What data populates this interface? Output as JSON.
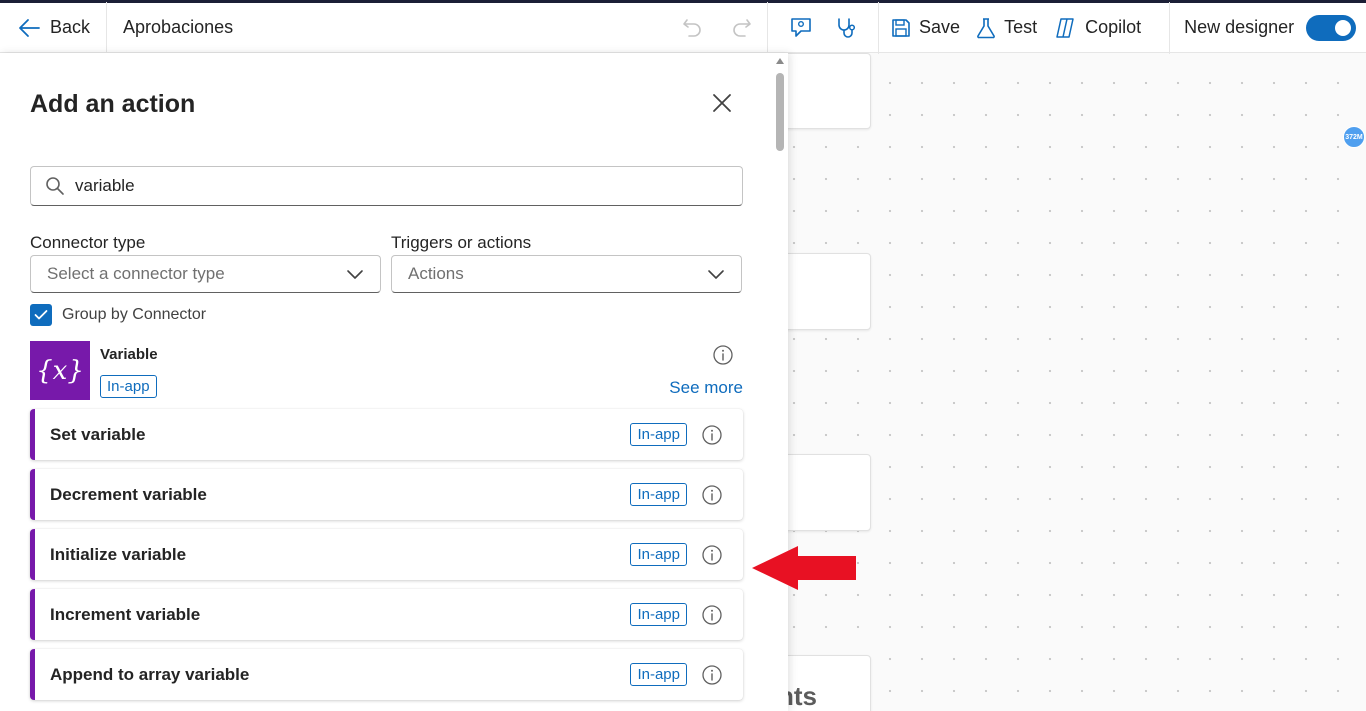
{
  "topbar": {
    "back_label": "Back",
    "flow_name": "Aprobaciones",
    "save_label": "Save",
    "test_label": "Test",
    "copilot_label": "Copilot",
    "new_designer_label": "New designer",
    "new_designer_on": true
  },
  "panel": {
    "title": "Add an action",
    "search_value": "variable",
    "connector_type_label": "Connector type",
    "connector_type_placeholder": "Select a connector type",
    "triggers_label": "Triggers or actions",
    "triggers_value": "Actions",
    "group_by_label": "Group by Connector",
    "group_by_checked": true
  },
  "connector": {
    "name": "Variable",
    "logo_text": "{x}",
    "badge": "In-app",
    "see_more": "See more",
    "color": "#7719aa"
  },
  "actions": [
    {
      "label": "Set variable",
      "badge": "In-app"
    },
    {
      "label": "Decrement variable",
      "badge": "In-app"
    },
    {
      "label": "Initialize variable",
      "badge": "In-app"
    },
    {
      "label": "Increment variable",
      "badge": "In-app"
    },
    {
      "label": "Append to array variable",
      "badge": "In-app"
    }
  ],
  "canvas": {
    "partial_text": "nts",
    "zoom_bubble": "372M"
  },
  "colors": {
    "accent": "#0f6cbd",
    "annotation_arrow": "#e81123"
  }
}
